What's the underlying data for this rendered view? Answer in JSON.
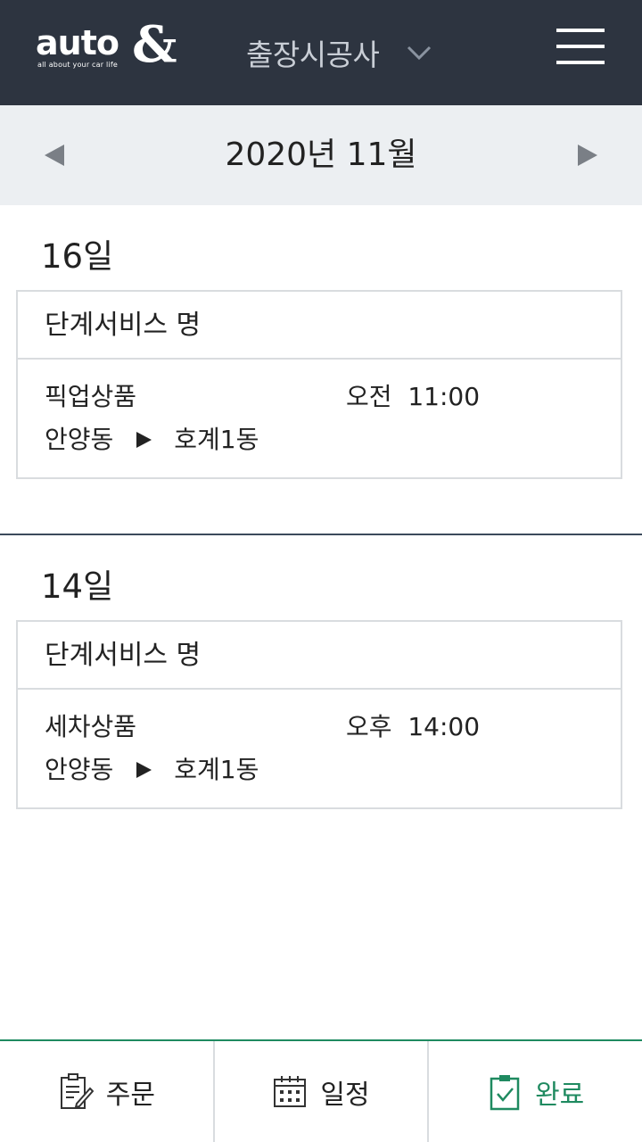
{
  "header": {
    "logo_text": "auto",
    "logo_amp": "&",
    "logo_tagline": "all about your car life",
    "company_name": "출장시공사"
  },
  "month_nav": {
    "label": "2020년  11월"
  },
  "days": [
    {
      "heading": "16일",
      "card": {
        "title": "단계서비스 명",
        "product": "픽업상품",
        "time": "오전  11:00",
        "from": "안양동",
        "to": "호계1동"
      }
    },
    {
      "heading": "14일",
      "card": {
        "title": "단계서비스 명",
        "product": "세차상품",
        "time": "오후  14:00",
        "from": "안양동",
        "to": "호계1동"
      }
    }
  ],
  "bottom_nav": {
    "items": [
      {
        "label": "주문",
        "icon": "order-icon",
        "active": false
      },
      {
        "label": "일정",
        "icon": "calendar-icon",
        "active": false
      },
      {
        "label": "완료",
        "icon": "clipboard-check-icon",
        "active": true
      }
    ]
  },
  "colors": {
    "header_bg": "#2d3440",
    "month_bar_bg": "#eceff2",
    "accent_green": "#1f8a60",
    "divider_dark": "#3c4a5c",
    "card_border": "#d9dcdf"
  }
}
